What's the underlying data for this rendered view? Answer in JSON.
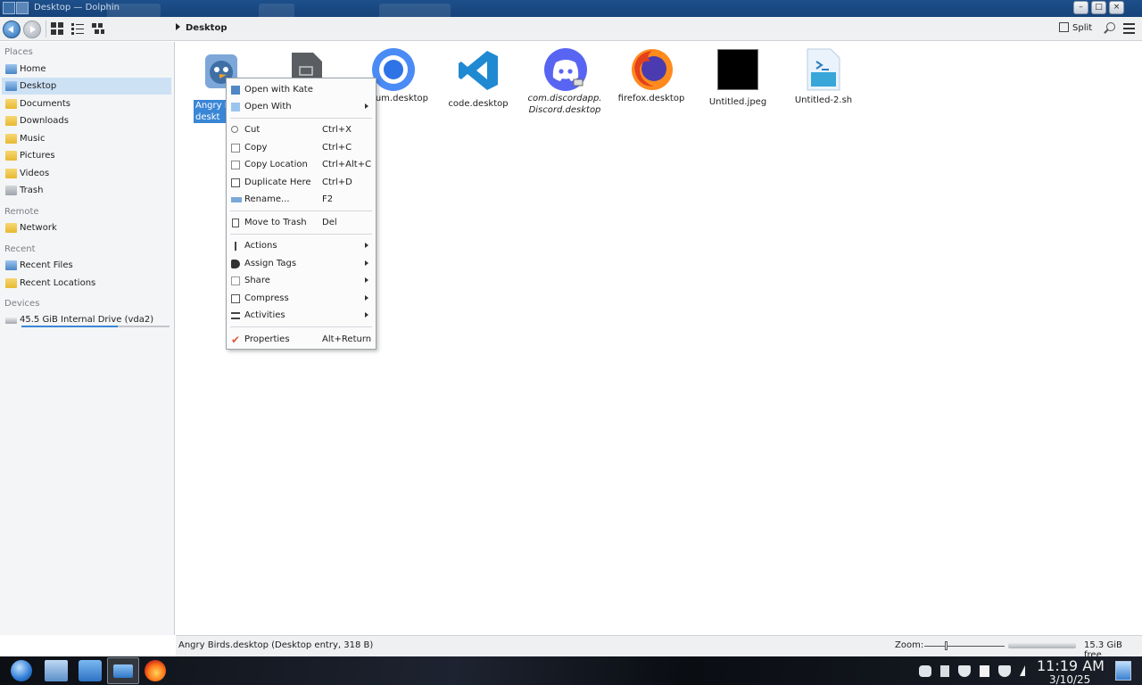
{
  "window": {
    "title": "Desktop — Dolphin",
    "controls": [
      "minimize",
      "maximize",
      "close"
    ]
  },
  "toolbar": {
    "breadcrumb": "Desktop",
    "split_label": "Split"
  },
  "sidebar": {
    "sections": {
      "places": "Places",
      "remote": "Remote",
      "recent": "Recent",
      "devices": "Devices"
    },
    "places": [
      {
        "label": "Home",
        "icon": "home-folder-icon",
        "active": false
      },
      {
        "label": "Desktop",
        "icon": "desktop-folder-icon",
        "active": true
      },
      {
        "label": "Documents",
        "icon": "documents-folder-icon",
        "active": false
      },
      {
        "label": "Downloads",
        "icon": "downloads-folder-icon",
        "active": false
      },
      {
        "label": "Music",
        "icon": "music-folder-icon",
        "active": false
      },
      {
        "label": "Pictures",
        "icon": "pictures-folder-icon",
        "active": false
      },
      {
        "label": "Videos",
        "icon": "videos-folder-icon",
        "active": false
      },
      {
        "label": "Trash",
        "icon": "trash-icon",
        "active": false
      }
    ],
    "remote": [
      {
        "label": "Network",
        "icon": "network-folder-icon"
      }
    ],
    "recent": [
      {
        "label": "Recent Files",
        "icon": "recent-files-icon"
      },
      {
        "label": "Recent Locations",
        "icon": "recent-locations-icon"
      }
    ],
    "devices": [
      {
        "label": "45.5 GiB Internal Drive (vda2)",
        "icon": "drive-icon",
        "usage_fraction": 0.65
      }
    ]
  },
  "files": [
    {
      "label": "Angry Birds.desktop",
      "visible_label": "Angry B… deskt…",
      "icon": "angry-birds-icon",
      "selected": true
    },
    {
      "label": "",
      "icon": "generic-file-icon",
      "selected": false
    },
    {
      "label": "chromium.desktop",
      "visible_label": "…mium.desktop",
      "icon": "chromium-icon",
      "selected": false
    },
    {
      "label": "code.desktop",
      "icon": "vscode-icon",
      "selected": false
    },
    {
      "label": "com.discordapp.Discord.desktop",
      "visible_label": "com.discordapp.\nDiscord.desktop",
      "icon": "discord-icon",
      "selected": false
    },
    {
      "label": "firefox.desktop",
      "icon": "firefox-icon",
      "selected": false
    },
    {
      "label": "Untitled.jpeg",
      "icon": "black-image-icon",
      "selected": false
    },
    {
      "label": "Untitled-2.sh",
      "icon": "shell-script-icon",
      "selected": false
    }
  ],
  "context_menu": {
    "items": [
      {
        "label": "Open with Kate",
        "shortcut": "",
        "submenu": false,
        "icon": "kate-icon"
      },
      {
        "label": "Open With",
        "shortcut": "",
        "submenu": true,
        "icon": "open-with-icon"
      },
      {
        "label": "Cut",
        "shortcut": "Ctrl+X",
        "submenu": false,
        "icon": "scissors-icon"
      },
      {
        "label": "Copy",
        "shortcut": "Ctrl+C",
        "submenu": false,
        "icon": "copy-icon"
      },
      {
        "label": "Copy Location",
        "shortcut": "Ctrl+Alt+C",
        "submenu": false,
        "icon": "copy-location-icon"
      },
      {
        "label": "Duplicate Here",
        "shortcut": "Ctrl+D",
        "submenu": false,
        "icon": "duplicate-icon"
      },
      {
        "label": "Rename...",
        "shortcut": "F2",
        "submenu": false,
        "icon": "rename-icon"
      },
      {
        "label": "Move to Trash",
        "shortcut": "Del",
        "submenu": false,
        "icon": "trash-icon"
      },
      {
        "label": "Actions",
        "shortcut": "",
        "submenu": true,
        "icon": "actions-icon"
      },
      {
        "label": "Assign Tags",
        "shortcut": "",
        "submenu": true,
        "icon": "tag-icon"
      },
      {
        "label": "Share",
        "shortcut": "",
        "submenu": true,
        "icon": "share-icon"
      },
      {
        "label": "Compress",
        "shortcut": "",
        "submenu": true,
        "icon": "compress-icon"
      },
      {
        "label": "Activities",
        "shortcut": "",
        "submenu": true,
        "icon": "activities-icon"
      },
      {
        "label": "Properties",
        "shortcut": "Alt+Return",
        "submenu": false,
        "icon": "properties-check-icon"
      }
    ]
  },
  "statusbar": {
    "selection": "Angry Birds.desktop (Desktop entry, 318 B)",
    "zoom_label": "Zoom:",
    "free_space": "15.3 GiB free"
  },
  "taskbar": {
    "apps": [
      "start-orb-icon",
      "system-settings-icon",
      "store-icon",
      "dolphin-icon",
      "firefox-icon"
    ],
    "tray": [
      "discord-tray-icon",
      "clipboard-icon",
      "shield-icon",
      "notes-icon",
      "shield-icon",
      "cursor-icon"
    ],
    "time": "11:19 AM",
    "date": "3/10/25"
  },
  "colors": {
    "accent": "#3a86d6",
    "sidebar_active": "#cde1f5",
    "titlebar": "#1d4f8a"
  }
}
